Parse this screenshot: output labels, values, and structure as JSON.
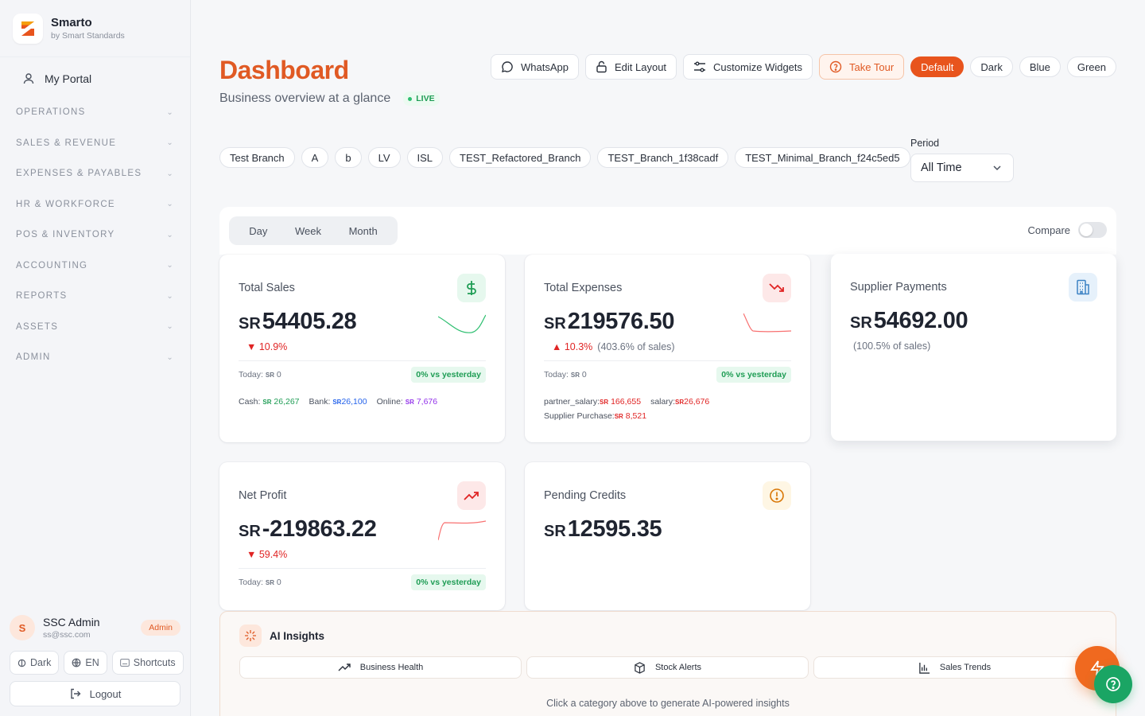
{
  "brand": {
    "name": "Smarto",
    "subtitle": "by Smart Standards"
  },
  "sidebar": {
    "portal_label": "My Portal",
    "groups": [
      {
        "label": "OPERATIONS"
      },
      {
        "label": "SALES & REVENUE"
      },
      {
        "label": "EXPENSES & PAYABLES"
      },
      {
        "label": "HR & WORKFORCE"
      },
      {
        "label": "POS & INVENTORY"
      },
      {
        "label": "ACCOUNTING"
      },
      {
        "label": "REPORTS"
      },
      {
        "label": "ASSETS"
      },
      {
        "label": "ADMIN"
      }
    ]
  },
  "user": {
    "initial": "S",
    "name": "SSC Admin",
    "email": "ss@ssc.com",
    "role": "Admin",
    "theme_label": "Dark",
    "lang_label": "EN",
    "shortcuts_label": "Shortcuts",
    "logout_label": "Logout"
  },
  "header": {
    "title": "Dashboard",
    "subtitle": "Business overview at a glance",
    "live_label": "LIVE",
    "actions": {
      "whatsapp": "WhatsApp",
      "edit_layout": "Edit Layout",
      "customize": "Customize Widgets",
      "tour": "Take Tour"
    },
    "themes": [
      "Default",
      "Dark",
      "Blue",
      "Green"
    ]
  },
  "branches": [
    "Test Branch",
    "A",
    "b",
    "LV",
    "ISL",
    "TEST_Refactored_Branch",
    "TEST_Branch_1f38cadf",
    "TEST_Minimal_Branch_f24c5ed5"
  ],
  "period": {
    "label": "Period",
    "value": "All Time"
  },
  "range": {
    "tabs": [
      "Day",
      "Week",
      "Month"
    ],
    "compare_label": "Compare"
  },
  "cards": {
    "total_sales": {
      "title": "Total Sales",
      "currency": "SR",
      "value": "54405.28",
      "change": "▼ 10.9%",
      "today_label": "Today:",
      "today_value": "0",
      "vs": "0% vs yesterday",
      "breakdown": [
        {
          "label": "Cash:",
          "value": "26,267",
          "color": "#1f9d55"
        },
        {
          "label": "Bank:",
          "value": "26,100",
          "color": "#2563eb"
        },
        {
          "label": "Online:",
          "value": "7,676",
          "color": "#9333ea"
        }
      ]
    },
    "total_expenses": {
      "title": "Total Expenses",
      "currency": "SR",
      "value": "219576.50",
      "change": "▲ 10.3%",
      "note": "(403.6% of sales)",
      "today_label": "Today:",
      "today_value": "0",
      "vs": "0% vs yesterday",
      "breakdown": [
        {
          "label": "partner_salary:",
          "value": "166,655",
          "color": "#e02424"
        },
        {
          "label": "salary:",
          "value": "26,676",
          "color": "#e02424"
        },
        {
          "label": "Supplier Purchase:",
          "value": "8,521",
          "color": "#e02424"
        }
      ]
    },
    "supplier_payments": {
      "title": "Supplier Payments",
      "currency": "SR",
      "value": "54692.00",
      "note": "(100.5% of sales)"
    },
    "net_profit": {
      "title": "Net Profit",
      "currency": "SR",
      "value": "-219863.22",
      "change": "▼ 59.4%",
      "today_label": "Today:",
      "today_value": "0",
      "vs": "0% vs yesterday"
    },
    "pending_credits": {
      "title": "Pending Credits",
      "currency": "SR",
      "value": "12595.35"
    }
  },
  "ai": {
    "title": "AI Insights",
    "tabs": [
      "Business Health",
      "Stock Alerts",
      "Sales Trends"
    ],
    "hint": "Click a category above to generate AI-powered insights"
  },
  "colors": {
    "accent": "#e05a24",
    "success": "#1f9d55",
    "danger": "#e02424"
  }
}
